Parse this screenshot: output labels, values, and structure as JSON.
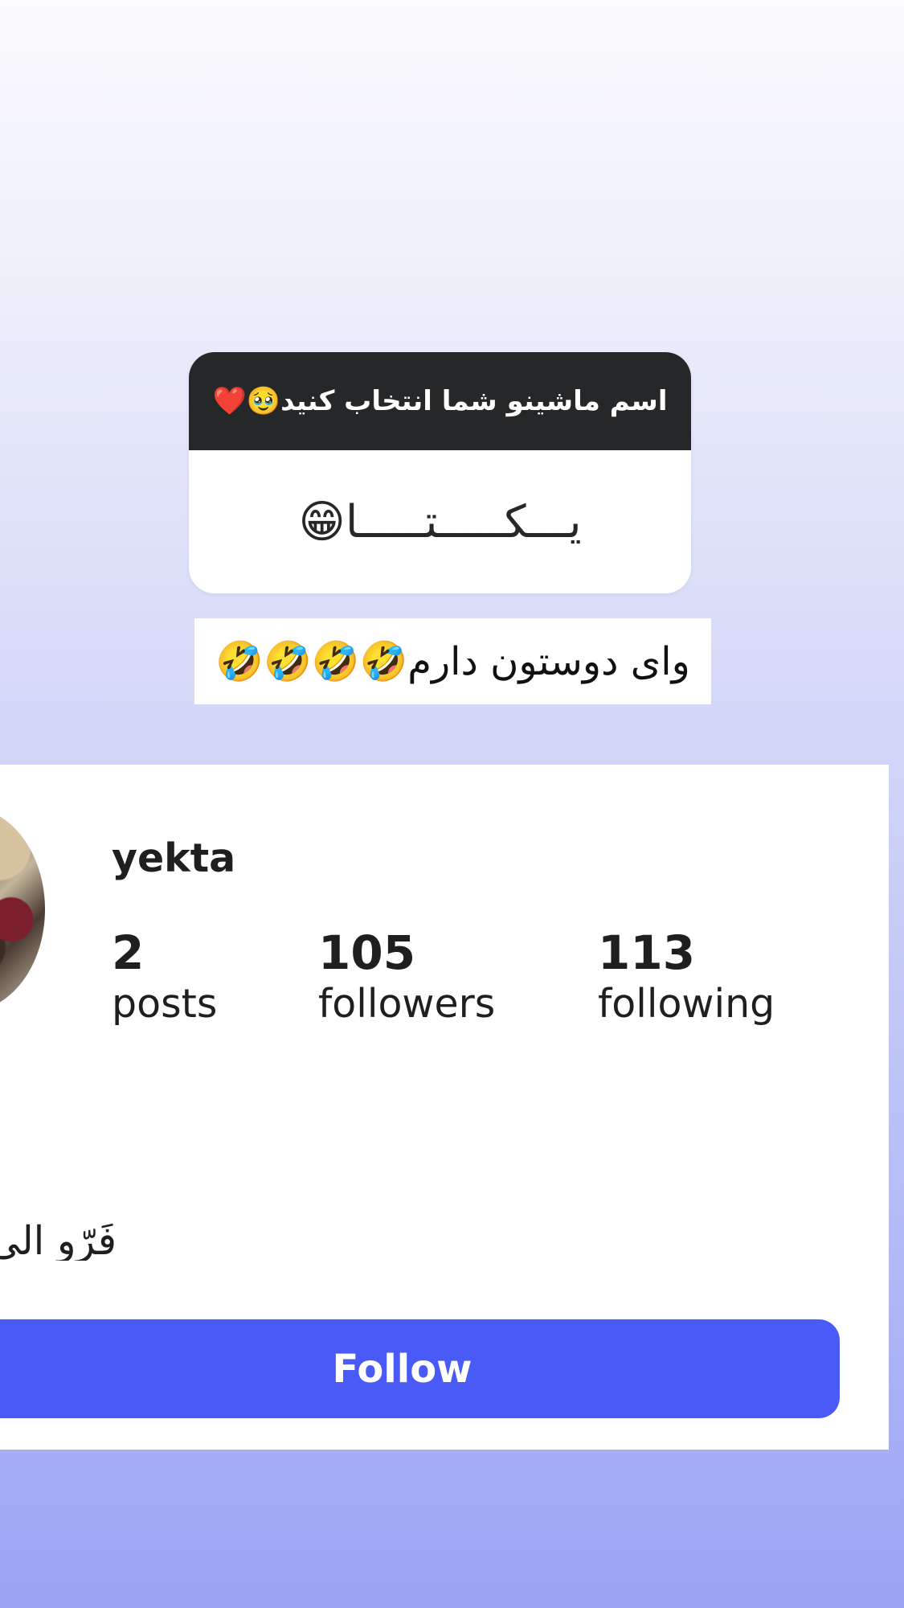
{
  "story": {
    "question_prompt": "اسم ماشینو شما انتخاب کنید🥹❤️",
    "question_answer": "یـــکـــــتـــــا😁",
    "caption": "وای دوستون دارم🤣🤣🤣🤣"
  },
  "profile": {
    "username": "yekta",
    "stats": [
      {
        "count": "2",
        "label": "posts"
      },
      {
        "count": "105",
        "label": "followers"
      },
      {
        "count": "113",
        "label": "following"
      }
    ],
    "bio_visible": "فَرّو الی",
    "follow_label": "Follow"
  },
  "colors": {
    "header_bg": "#262729",
    "follow_button": "#4a5af7",
    "card_bg": "#ffffff",
    "text_primary": "#1f1f1f"
  }
}
